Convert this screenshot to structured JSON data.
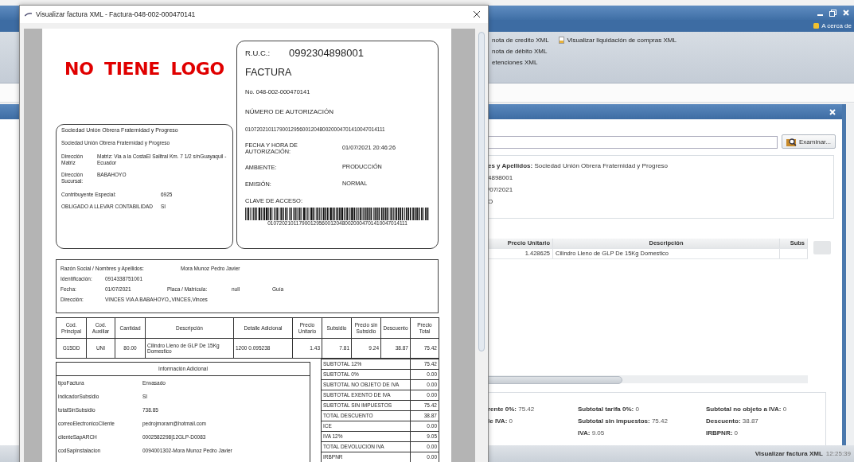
{
  "background_window": {
    "menu_item": "A cerca de",
    "ribbon_columns": [
      [
        {
          "kind": "plain",
          "label": "nota de credito XML"
        },
        {
          "kind": "plain",
          "label": "nota de débito XML"
        },
        {
          "kind": "plain",
          "label": "etenciones XML"
        }
      ],
      [
        {
          "kind": "icon",
          "label": "Visualizar liquidación de compras XML"
        }
      ]
    ],
    "browse_button": "Examinar...",
    "info_lines": [
      "**es y Apellidos:** Sociedad Unión Obrera Fraternidad y Progreso",
      "4898001",
      "/07/2021",
      "O"
    ],
    "table": {
      "columns": [
        "Precio Unitario",
        "Descripción",
        "Subs"
      ],
      "rows": [
        [
          "1.428625",
          "Cilindro Lleno de GLP De 15Kg Domestico"
        ]
      ]
    },
    "summary_columns": [
      [
        "**rente 0%:** 75.42",
        "**le IVA:** 0"
      ],
      [
        "**Subtotal tarifa 0%:** 0",
        "**Subtotal sin impuestos:** 75.42",
        "**IVA:** 9.05"
      ],
      [
        "**Subtotal no objeto a IVA:** 0",
        "**Descuento:** 38.87",
        "**IRBPNR:** 0"
      ]
    ],
    "status_bar": {
      "title": "Visualizar factura XML",
      "time": "12:25:39"
    }
  },
  "dialog": {
    "title": "Visualizar factura XML - Factura-048-002-000470141",
    "invoice": {
      "logo_text": "NO TIENE LOGO",
      "ruc_label": "R.U.C.:",
      "ruc": "0992304898001",
      "doc_type": "FACTURA",
      "number": "No. 048-002-000470141",
      "auth_label": "NÚMERO DE AUTORIZACIÓN",
      "auth_number": "0107202101179001295600120480020004701410047014111",
      "auth_fields": [
        {
          "label": "FECHA Y HORA DE AUTORIZACIÓN:",
          "value": "01/07/2021 20:46:26"
        },
        {
          "label": "AMBIENTE:",
          "value": "PRODUCCIÓN"
        },
        {
          "label": "EMISIÓN:",
          "value": "NORMAL"
        }
      ],
      "access_label": "CLAVE DE ACCESO:",
      "access_key": "0107202101179001295600120480020004701410047014111",
      "company": {
        "name": "Sociedad Unión Obrera Fraternidad y Progreso",
        "trade_name": "Sociedad Unión Obrera Fraternidad y Progreso",
        "addresses": [
          {
            "label": "Dirección Matriz",
            "value": "Matriz: Via a la CostaEl Salitral Km. 7 1/2 s/nGuayaquil - Ecuador"
          },
          {
            "label": "Dirección Sucursal:",
            "value": "BABAHOYO"
          }
        ],
        "flags": [
          {
            "label": "Contribuyente Especial:",
            "value": "6925"
          },
          {
            "label": "OBLIGADO A LLEVAR CONTABILIDAD",
            "value": "SI"
          }
        ]
      },
      "customer_rows": [
        [
          "Razón Social / Nombres y Apellidos:",
          "Mora Munoz Pedro Javier"
        ],
        [
          "Identificación:",
          "0914338751001"
        ],
        [
          "Fecha:",
          "01/07/2021",
          "Placa / Matrícula:",
          "null",
          "Guía"
        ],
        [
          "Dirección:",
          "VINCES VIA A BABAHOYO,,VINCES,Vinces"
        ]
      ],
      "items": {
        "columns": [
          "Cod. Principal",
          "Cod. Auxiliar",
          "Cantidad",
          "Descripción",
          "Detalle Adicional",
          "Precio Unitario",
          "Subsidio",
          "Precio sin Subsidio",
          "Descuento",
          "Precio Total"
        ],
        "rows": [
          [
            "G15DD",
            "UNI",
            "80.00",
            "Cilindro Lleno de GLP De 15Kg Domestico",
            "1200 0.095238",
            "1.43",
            "7.81",
            "9.24",
            "38.87",
            "75.42"
          ]
        ]
      },
      "additional_title": "Información Adicional",
      "additional": [
        {
          "key": "tipoFactura",
          "value": "Envasado"
        },
        {
          "key": "indicadorSubsidio",
          "value": "SI"
        },
        {
          "key": "totalSinSubsidio",
          "value": "738.85"
        },
        {
          "key": "correoElectronicoCliente",
          "value": "pedrojmoram@hotmail.com"
        },
        {
          "key": "clienteSapARCH",
          "value": "0002582298|12GLP-D0083"
        },
        {
          "key": "codSapInstalacion",
          "value": "0094001302-Mora Munoz Pedro Javier"
        }
      ],
      "totals": [
        {
          "label": "SUBTOTAL 12%",
          "value": "75.42"
        },
        {
          "label": "SUBTOTAL 0%",
          "value": "0.00"
        },
        {
          "label": "SUBTOTAL NO OBJETO DE IVA",
          "value": "0.00"
        },
        {
          "label": "SUBTOTAL EXENTO DE IVA",
          "value": "0.00"
        },
        {
          "label": "SUBTOTAL SIN IMPUESTOS",
          "value": "75.42"
        },
        {
          "label": "TOTAL DESCUENTO",
          "value": "38.87"
        },
        {
          "label": "ICE",
          "value": "0.00"
        },
        {
          "label": "IVA 12%",
          "value": "9.05"
        },
        {
          "label": "TOTAL DEVOLUCION IVA",
          "value": "0.00"
        },
        {
          "label": "IRBPNR",
          "value": "0.00"
        }
      ]
    }
  }
}
